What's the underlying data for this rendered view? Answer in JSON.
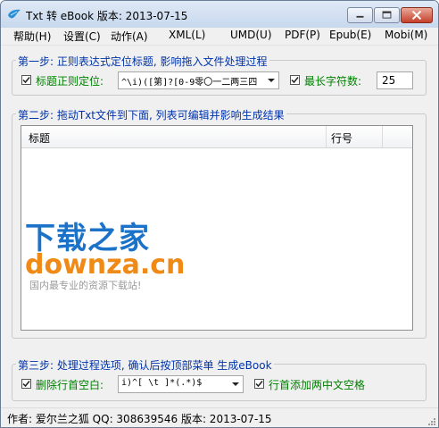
{
  "window": {
    "title": "Txt 转 eBook 版本: 2013-07-15"
  },
  "menu": [
    "帮助(H)",
    "设置(C)",
    "动作(A)",
    "XML(L)",
    "UMD(U)",
    "PDF(P)",
    "Epub(E)",
    "Mobi(M)"
  ],
  "step1": {
    "title": "第一步: 正则表达式定位标题, 影响拖入文件处理过程",
    "title_regex_label": "标题正则定位:",
    "title_regex_checked": true,
    "title_regex_value": "^\\i)([第]?[0-9零〇一二两三四",
    "maxlen_label": "最长字符数:",
    "maxlen_checked": true,
    "maxlen_value": "25"
  },
  "step2": {
    "title": "第二步: 拖动Txt文件到下面, 列表可编辑并影响生成结果",
    "columns": [
      "标题",
      "行号"
    ],
    "rows": []
  },
  "watermark": {
    "title": "下载之家",
    "domain": "downza.cn",
    "slogan": "国内最专业的资源下载站!"
  },
  "step3": {
    "title": "第三步: 处理过程选项, 确认后按顶部菜单 生成eBook",
    "remove_blank_label": "删除行首空白:",
    "remove_blank_checked": true,
    "remove_blank_value": "i)^[ \\t  ]*(.*)$",
    "add_space_label": "行首添加两中文空格",
    "add_space_checked": true
  },
  "status": "作者: 爱尔兰之狐   QQ: 308639546   版本: 2013-07-15",
  "icons": {
    "app": "app-bird-icon",
    "minimize": "minimize-icon",
    "maximize": "maximize-icon",
    "close": "close-icon",
    "dropdown": "chevron-down-icon",
    "check": "check-icon"
  }
}
